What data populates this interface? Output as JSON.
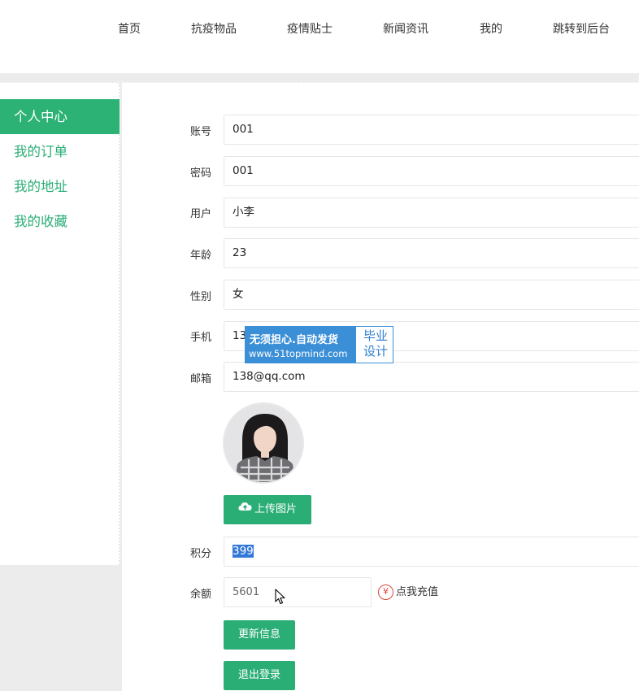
{
  "nav": {
    "items": [
      "首页",
      "抗疫物品",
      "疫情贴士",
      "新闻资讯",
      "我的",
      "跳转到后台"
    ]
  },
  "sidebar": {
    "items": [
      {
        "label": "个人中心",
        "active": true
      },
      {
        "label": "我的订单",
        "active": false
      },
      {
        "label": "我的地址",
        "active": false
      },
      {
        "label": "我的收藏",
        "active": false
      }
    ]
  },
  "form": {
    "account": {
      "label": "账号",
      "value": "001"
    },
    "password": {
      "label": "密码",
      "value": "001"
    },
    "username": {
      "label": "用户",
      "value": "小李"
    },
    "age": {
      "label": "年龄",
      "value": "23"
    },
    "gender": {
      "label": "性别",
      "value": "女"
    },
    "phone": {
      "label": "手机",
      "value": "13"
    },
    "email": {
      "label": "邮箱",
      "value": "138@qq.com"
    },
    "points": {
      "label": "积分",
      "value": "399"
    },
    "balance": {
      "label": "余额",
      "value": "5601"
    }
  },
  "buttons": {
    "upload": "上传图片",
    "recharge": "点我充值",
    "update": "更新信息",
    "logout": "退出登录"
  },
  "watermark": {
    "line1": "无须担心.自动发货",
    "line2": "www.51topmind.com",
    "right": "毕业设计"
  },
  "colors": {
    "accent": "#2bae76",
    "selection": "#3478d8",
    "recharge_icon": "#e0463a"
  }
}
